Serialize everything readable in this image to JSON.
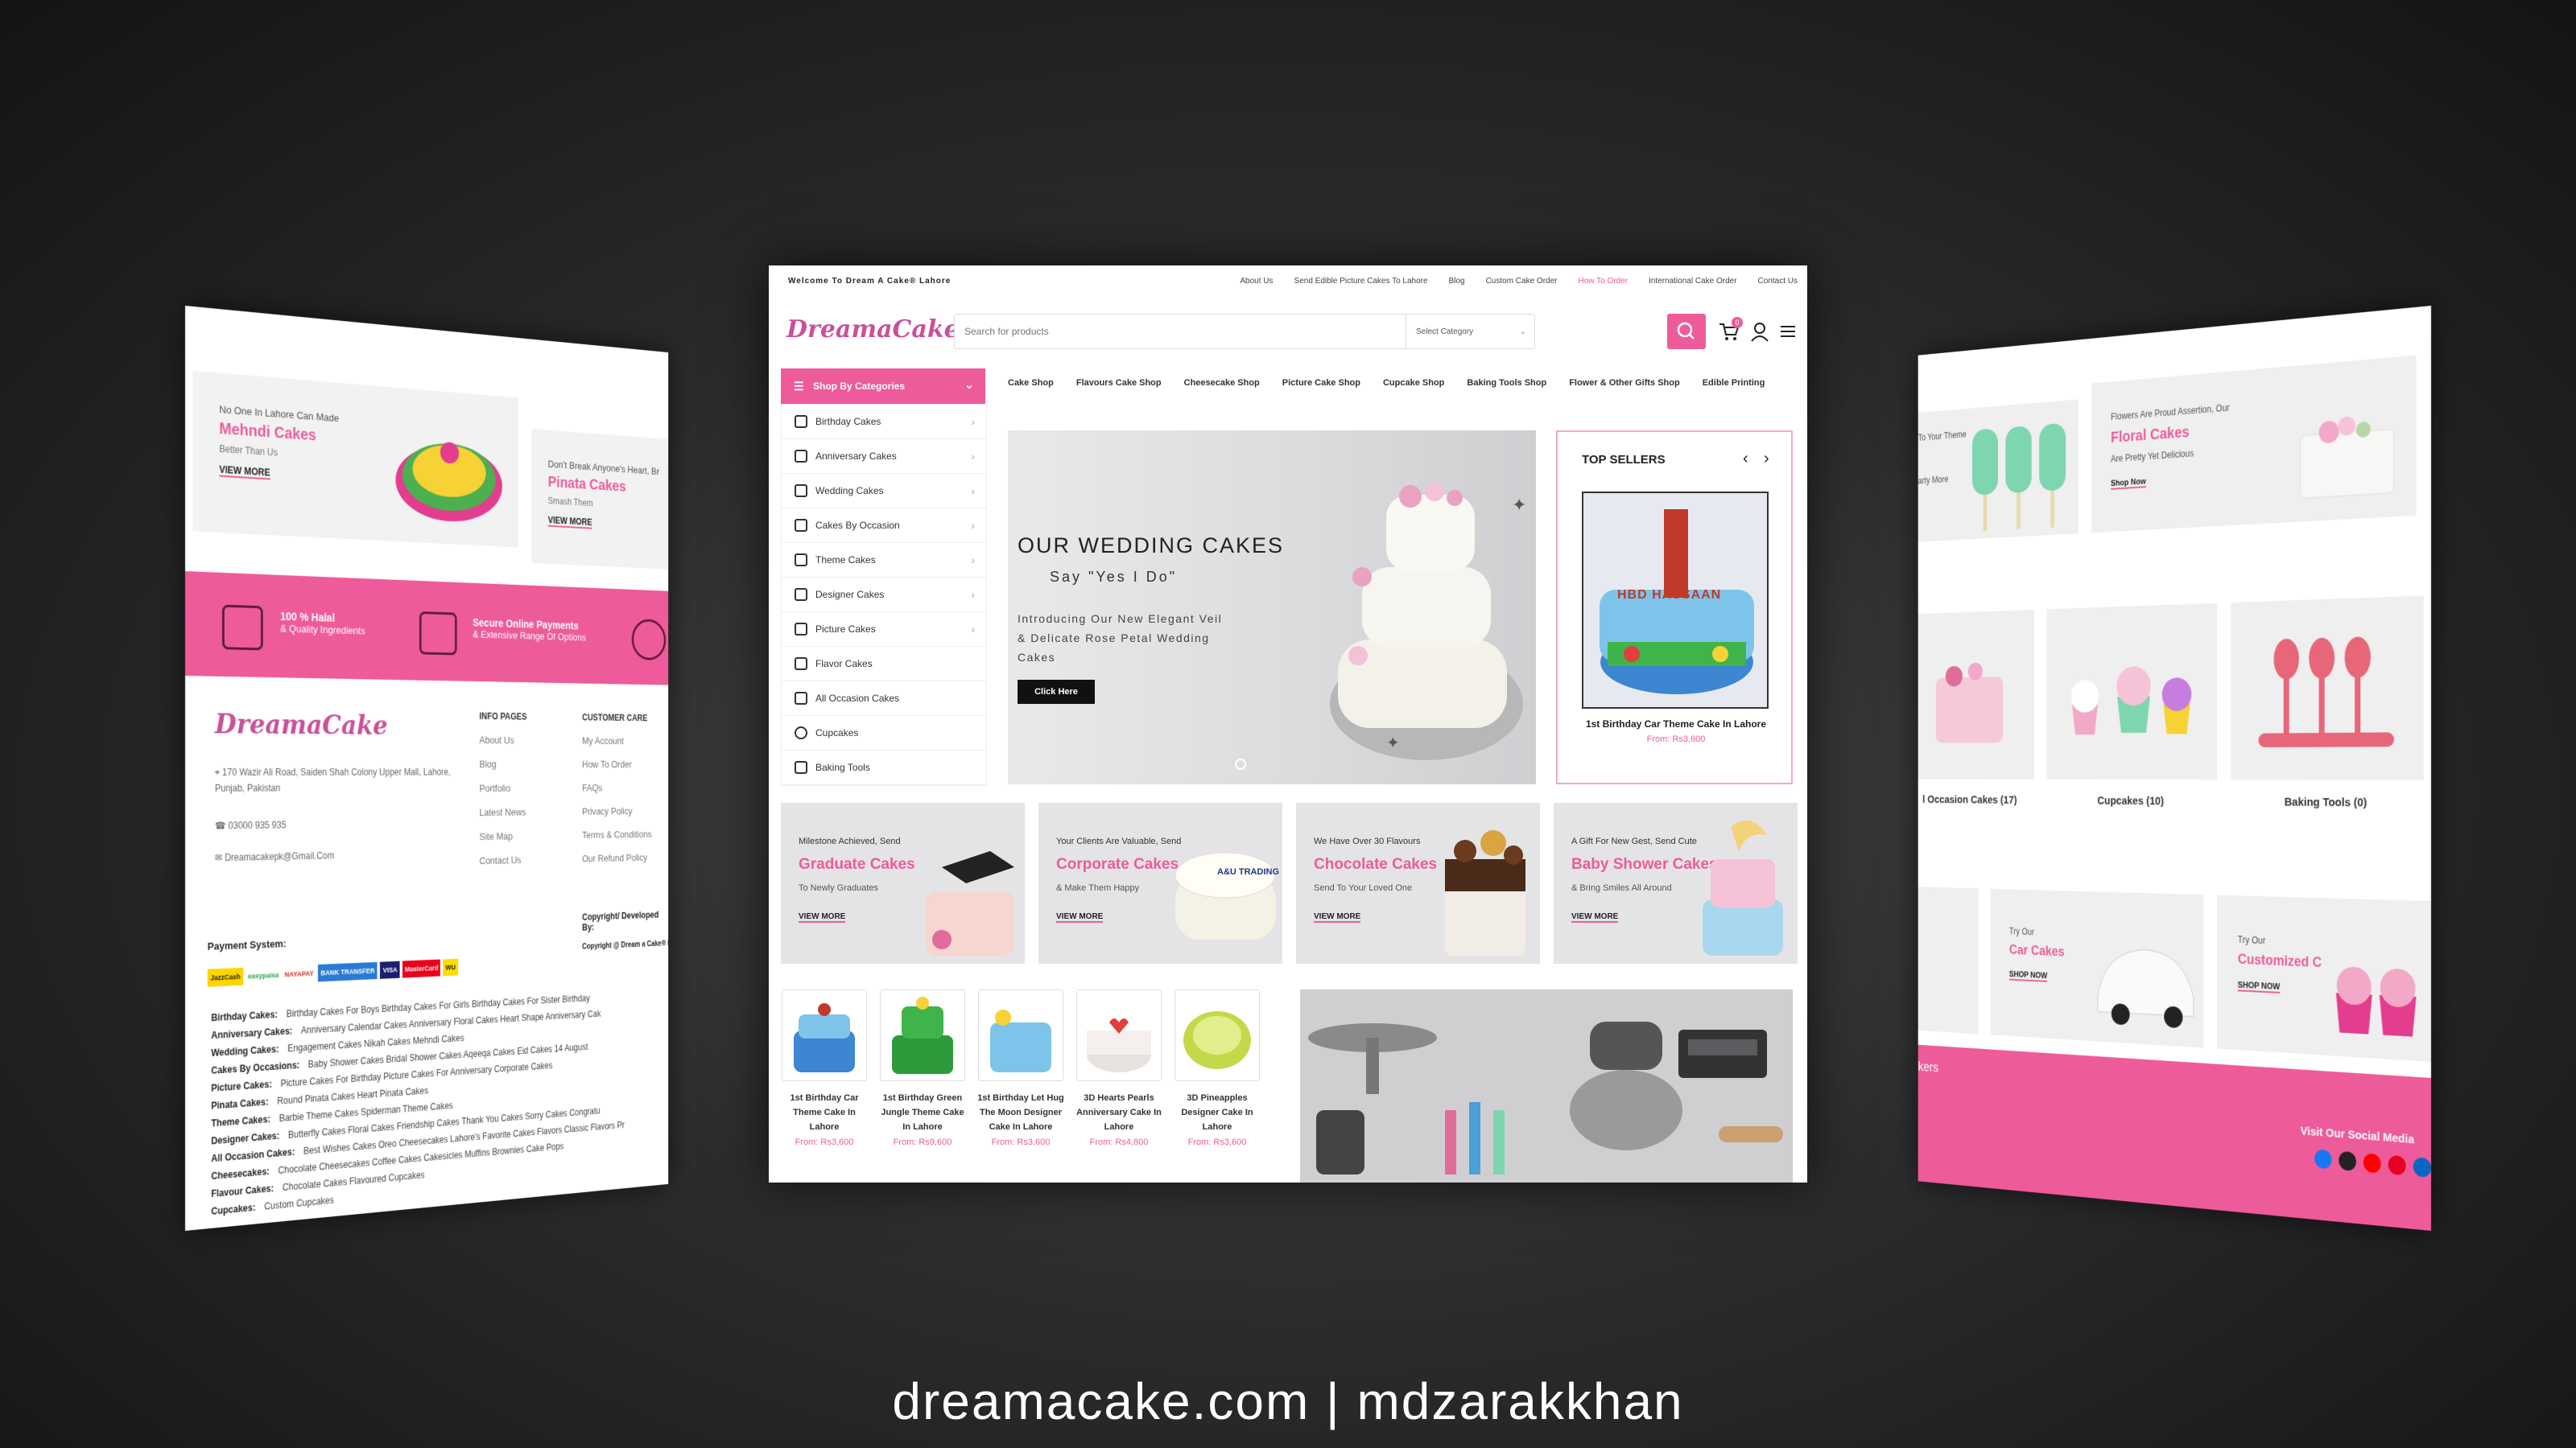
{
  "caption": "dreamacake.com | mdzarakkhan",
  "colors": {
    "accent": "#ee5b9a",
    "dark": "#111111"
  },
  "left_panel": {
    "promos": [
      {
        "kicker": "No One In Lahore Can Made",
        "title": "Mehndi Cakes",
        "sub": "Better Than Us",
        "link": "VIEW MORE"
      },
      {
        "kicker": "Don't Break Anyone's Heart, Br",
        "title": "Pinata Cakes",
        "sub": "Smash Them",
        "link": "VIEW MORE"
      }
    ],
    "features": [
      {
        "title": "100 % Halal",
        "sub": "& Quality Ingredients"
      },
      {
        "title": "Secure Online Payments",
        "sub": "& Extensive Range Of Options"
      }
    ],
    "logo": "DreamaCake",
    "address": "170 Wazir Ali Road, Saiden Shah Colony Upper Mall, Lahore, Punjab, Pakistan",
    "phone": "03000 935 935",
    "email": "Dreamacakepk@Gmail.Com",
    "info_pages": {
      "heading": "INFO PAGES",
      "items": [
        "About Us",
        "Blog",
        "Portfolio",
        "Latest News",
        "Site Map",
        "Contact Us"
      ]
    },
    "customer_care": {
      "heading": "CUSTOMER CARE",
      "items": [
        "My Account",
        "How To Order",
        "FAQs",
        "Privacy Policy",
        "Terms & Conditions",
        "Our Refund Policy"
      ]
    },
    "copyright_heading": "Copyright/ Developed By:",
    "copyright_text": "Copyright @ Dream a Cake® Lahore 20",
    "payment_label": "Payment System:",
    "payment_methods": [
      "JazzCash",
      "easypaisa",
      "NAYAPAY",
      "BANK TRANSFER",
      "VISA",
      "MasterCard",
      "WU"
    ],
    "category_lines": [
      {
        "label": "Birthday Cakes:",
        "items": "Birthday Cakes For Boys   Birthday Cakes For Girls   Birthday Cakes For Sister   Birthday"
      },
      {
        "label": "Anniversary Cakes:",
        "items": "Anniversary Calendar Cakes   Anniversary Floral Cakes   Heart Shape Anniversary Cak"
      },
      {
        "label": "Wedding Cakes:",
        "items": "Engagement Cakes   Nikah Cakes   Mehndi Cakes"
      },
      {
        "label": "Cakes By Occasions:",
        "items": "Baby Shower Cakes   Bridal Shower Cakes   Aqeeqa Cakes   Eid Cakes   14 August"
      },
      {
        "label": "Picture Cakes:",
        "items": "Picture Cakes For Birthday   Picture Cakes For Anniversary   Corporate Cakes"
      },
      {
        "label": "Pinata Cakes:",
        "items": "Round Pinata Cakes   Heart Pinata Cakes"
      },
      {
        "label": "Theme Cakes:",
        "items": "Barbie Theme Cakes   Spiderman Theme Cakes"
      },
      {
        "label": "Designer Cakes:",
        "items": "Butterfly Cakes   Floral Cakes   Friendship Cakes   Thank You Cakes   Sorry Cakes   Congratu"
      },
      {
        "label": "All Occasion Cakes:",
        "items": "Best Wishes Cakes   Oreo Cheesecakes   Lahore's Favorite Cakes Flavors   Classic Flavors   Pr"
      },
      {
        "label": "Cheesecakes:",
        "items": "Chocolate Cheesecakes   Coffee Cakes   Cakesicles   Muffins   Brownies   Cake Pops"
      },
      {
        "label": "Flavour Cakes:",
        "items": "Chocolate Cakes   Flavoured Cupcakes"
      },
      {
        "label": "Cupcakes:",
        "items": "Custom Cupcakes"
      }
    ]
  },
  "center_panel": {
    "welcome": "Welcome To Dream A Cake® Lahore",
    "top_links": [
      "About Us",
      "Send Edible Picture Cakes To Lahore",
      "Blog",
      "Custom Cake Order",
      "How To Order",
      "International Cake Order",
      "Contact Us"
    ],
    "logo": "DreamaCake",
    "search_placeholder": "Search for products",
    "select_category": "Select Category",
    "cart_count": "0",
    "shop_by_categories": "Shop By Categories",
    "side_categories": [
      "Birthday Cakes",
      "Anniversary Cakes",
      "Wedding Cakes",
      "Cakes By Occasion",
      "Theme Cakes",
      "Designer Cakes",
      "Picture Cakes",
      "Flavor Cakes",
      "All Occasion Cakes",
      "Cupcakes",
      "Baking Tools"
    ],
    "main_nav": [
      "Cake Shop",
      "Flavours Cake Shop",
      "Cheesecake Shop",
      "Picture Cake Shop",
      "Cupcake Shop",
      "Baking Tools Shop",
      "Flower & Other Gifts Shop",
      "Edible Printing"
    ],
    "hero": {
      "title": "OUR WEDDING CAKES",
      "subtitle": "Say \"Yes I Do\"",
      "desc": "Introducing Our New Elegant Veil & Delicate Rose Petal Wedding Cakes",
      "button": "Click Here"
    },
    "top_sellers": {
      "heading": "TOP SELLERS",
      "name": "1st Birthday Car Theme Cake In Lahore",
      "price": "From: Rs3,600",
      "cake_text": "HBD HASSAAN"
    },
    "promos": [
      {
        "kicker": "Milestone Achieved, Send",
        "title": "Graduate Cakes",
        "sub": "To Newly Graduates",
        "link": "VIEW MORE"
      },
      {
        "kicker": "Your Clients Are Valuable, Send",
        "title": "Corporate Cakes",
        "sub": "& Make Them Happy",
        "link": "VIEW MORE",
        "cake_text": "A&U TRADING"
      },
      {
        "kicker": "We Have Over 30 Flavours",
        "title": "Chocolate Cakes",
        "sub": "Send To Your Loved One",
        "link": "VIEW MORE"
      },
      {
        "kicker": "A Gift For New Gest, Send Cute",
        "title": "Baby Shower Cakes",
        "sub": "& Bring Smiles All Around",
        "link": "VIEW MORE"
      }
    ],
    "products": [
      {
        "name": "1st Birthday Car Theme Cake In Lahore",
        "price": "From: Rs3,600",
        "color": "#3d86d1"
      },
      {
        "name": "1st Birthday Green Jungle Theme Cake In Lahore",
        "price": "From: Rs9,600",
        "color": "#3fb44a"
      },
      {
        "name": "1st Birthday Let Hug The Moon Designer Cake In Lahore",
        "price": "From: Rs3,600",
        "color": "#7ec4ea"
      },
      {
        "name": "3D Hearts Pearls Anniversary Cake In Lahore",
        "price": "From: Rs4,800",
        "color": "#e8e2df"
      },
      {
        "name": "3D Pineapples Designer Cake In Lahore",
        "price": "From: Rs3,600",
        "color": "#c4d94a"
      }
    ]
  },
  "right_panel": {
    "promos": [
      {
        "kicker": "To Your Theme",
        "sub": "arty More"
      },
      {
        "kicker": "Flowers Are Proud Assertion, Our",
        "title": "Floral Cakes",
        "sub": "Are Pretty Yet Delicious",
        "link": "Shop Now"
      }
    ],
    "categories": [
      {
        "label": "l Occasion Cakes (17)"
      },
      {
        "label": "Cupcakes (10)"
      },
      {
        "label": "Baking Tools (0)"
      }
    ],
    "bottom_promos": [
      {
        "kicker": "Try Our",
        "title": "Car Cakes",
        "link": "SHOP NOW"
      },
      {
        "kicker": "Try Our",
        "title": "Customized C",
        "link": "SHOP NOW"
      }
    ],
    "band_text": "akers",
    "social_heading": "Visit Our Social Media"
  }
}
